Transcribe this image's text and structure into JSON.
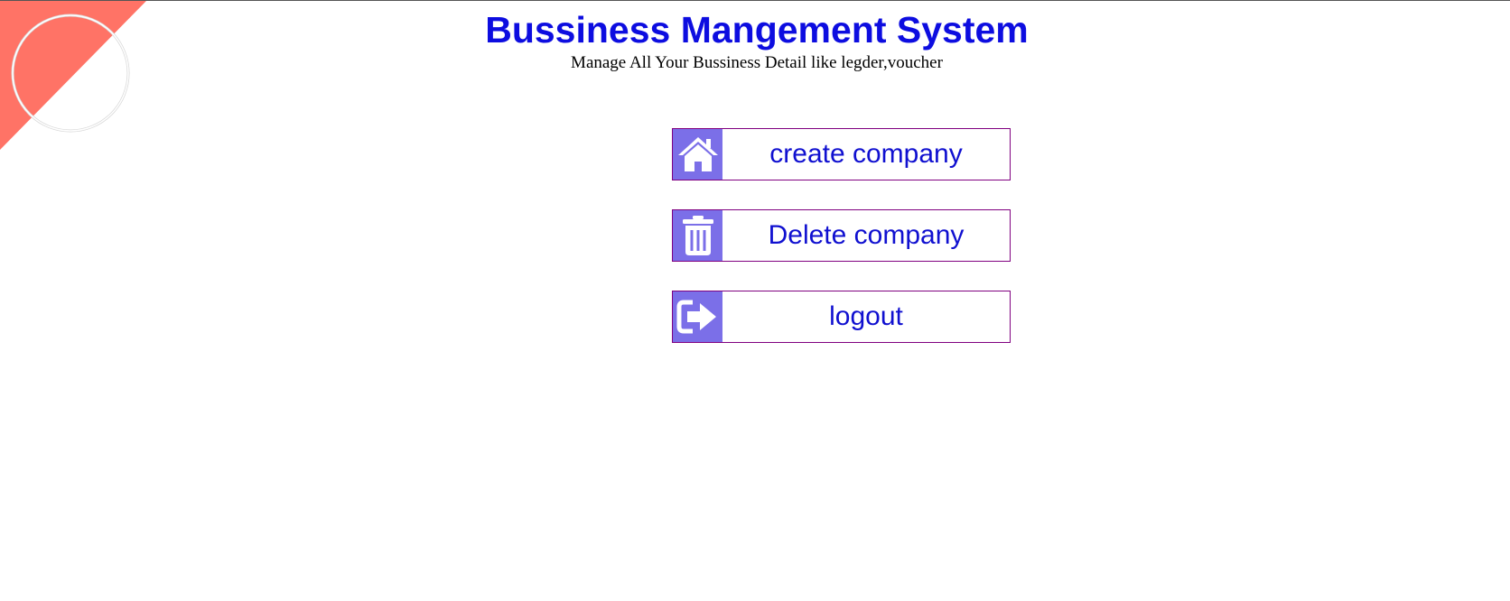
{
  "header": {
    "title": "Bussiness Mangement System",
    "subtitle": "Manage All Your Bussiness Detail like legder,voucher"
  },
  "actions": [
    {
      "label": "create company",
      "icon": "home-icon"
    },
    {
      "label": "Delete company",
      "icon": "trash-icon"
    },
    {
      "label": "logout",
      "icon": "logout-icon"
    }
  ],
  "colors": {
    "title": "#0d0de0",
    "button_text": "#1010d0",
    "icon_background": "#7b6fe8",
    "button_border": "#800080",
    "corner_accent": "#ff7366"
  }
}
